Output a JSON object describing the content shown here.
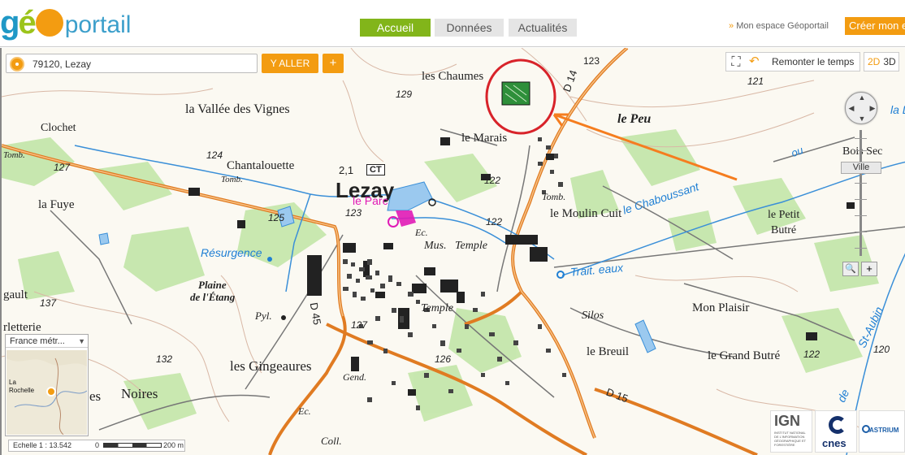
{
  "header": {
    "logo": {
      "geo_letters": "gé",
      "portail": "portail"
    },
    "tabs": [
      {
        "label": "Accueil",
        "active": true
      },
      {
        "label": "Données",
        "active": false
      },
      {
        "label": "Actualités",
        "active": false
      }
    ],
    "mon_espace": "Mon espace Géoportail",
    "creer": "Créer mon e"
  },
  "search": {
    "value": "79120, Lezay",
    "go_label": "Y ALLER",
    "plus_label": "+"
  },
  "view": {
    "remonter": "Remonter le temps",
    "mode_2d": "2D",
    "mode_3d": "3D"
  },
  "zoom": {
    "level_label": "Ville",
    "zoom_out": "🔍",
    "zoom_in": "+"
  },
  "overview": {
    "projection": "France métr...",
    "place_label_1": "La",
    "place_label_2": "Rochelle"
  },
  "scale": {
    "text": "Echelle 1 : 13.542",
    "zero": "0",
    "distance": "200 m"
  },
  "logos": {
    "ign": "IGN",
    "ign_sub": "INSTITUT NATIONAL DE L'INFORMATION GÉOGRAPHIQUE ET FORESTIÈRE",
    "cnes": "cnes",
    "astrium": "ASTRIUM"
  },
  "map_labels": {
    "les_chaumes": "les Chaumes",
    "la_vallee": "la Vallée des Vignes",
    "clochet": "Clochet",
    "tomb_1": "Tomb.",
    "chantalouette": "Chantalouette",
    "tomb_2": "Tomb.",
    "la_fuye": "la Fuye",
    "lezay": "Lezay",
    "ct": "CT",
    "v21": "2,1",
    "le_marais": "le Marais",
    "le_peu": "le Peu",
    "tomb_3": "Tomb.",
    "le_moulin_cuit": "le Moulin Cuit",
    "le_chaboussant": "le Chaboussant",
    "ou": "ou",
    "bois_sec": "Bois Sec",
    "le_petit_butre": "le Petit",
    "butre": "Butré",
    "resurgence": "Résurgence",
    "le_parc": "le Parc",
    "temple_1": "Temple",
    "mus": "Mus.",
    "ec_1": "Ec.",
    "trait_eaux": "Trait. eaux",
    "plaine": "Plaine",
    "de_letang": "de l'Étang",
    "pyl": "Pyl.",
    "d45": "D 45",
    "temple_2": "Temple",
    "silos": "Silos",
    "le_breuil": "le Breuil",
    "mon_plaisir": "Mon Plaisir",
    "le_grand_butre": "le Grand Butré",
    "gault": "gault",
    "rletterie": "rletterie",
    "les_gingeaures": "les Gingeaures",
    "gend": "Gend.",
    "noires": "Noires",
    "es": "es",
    "ec_2": "Ec.",
    "coll": "Coll.",
    "d15": "D 15",
    "d14": "D 14",
    "st_aubin": "St-Aubin",
    "de": "de",
    "ru": "ru",
    "la_di": "la Di",
    "n129": "129",
    "n123a": "123",
    "n121": "121",
    "n127": "127",
    "n124": "124",
    "n123b": "123",
    "n122a": "122",
    "n125": "125",
    "n122b": "122",
    "n137": "137",
    "n132": "132",
    "n127b": "127",
    "n126": "126",
    "n122c": "122",
    "n120": "120"
  },
  "colors": {
    "accent": "#f39c11",
    "nav_active": "#82b51a",
    "annotation_circle": "#d8232a",
    "annotation_arrow": "#f57d1f",
    "road": "#e07b22",
    "water": "#3a8fd8",
    "forest": "#b9e29a"
  }
}
